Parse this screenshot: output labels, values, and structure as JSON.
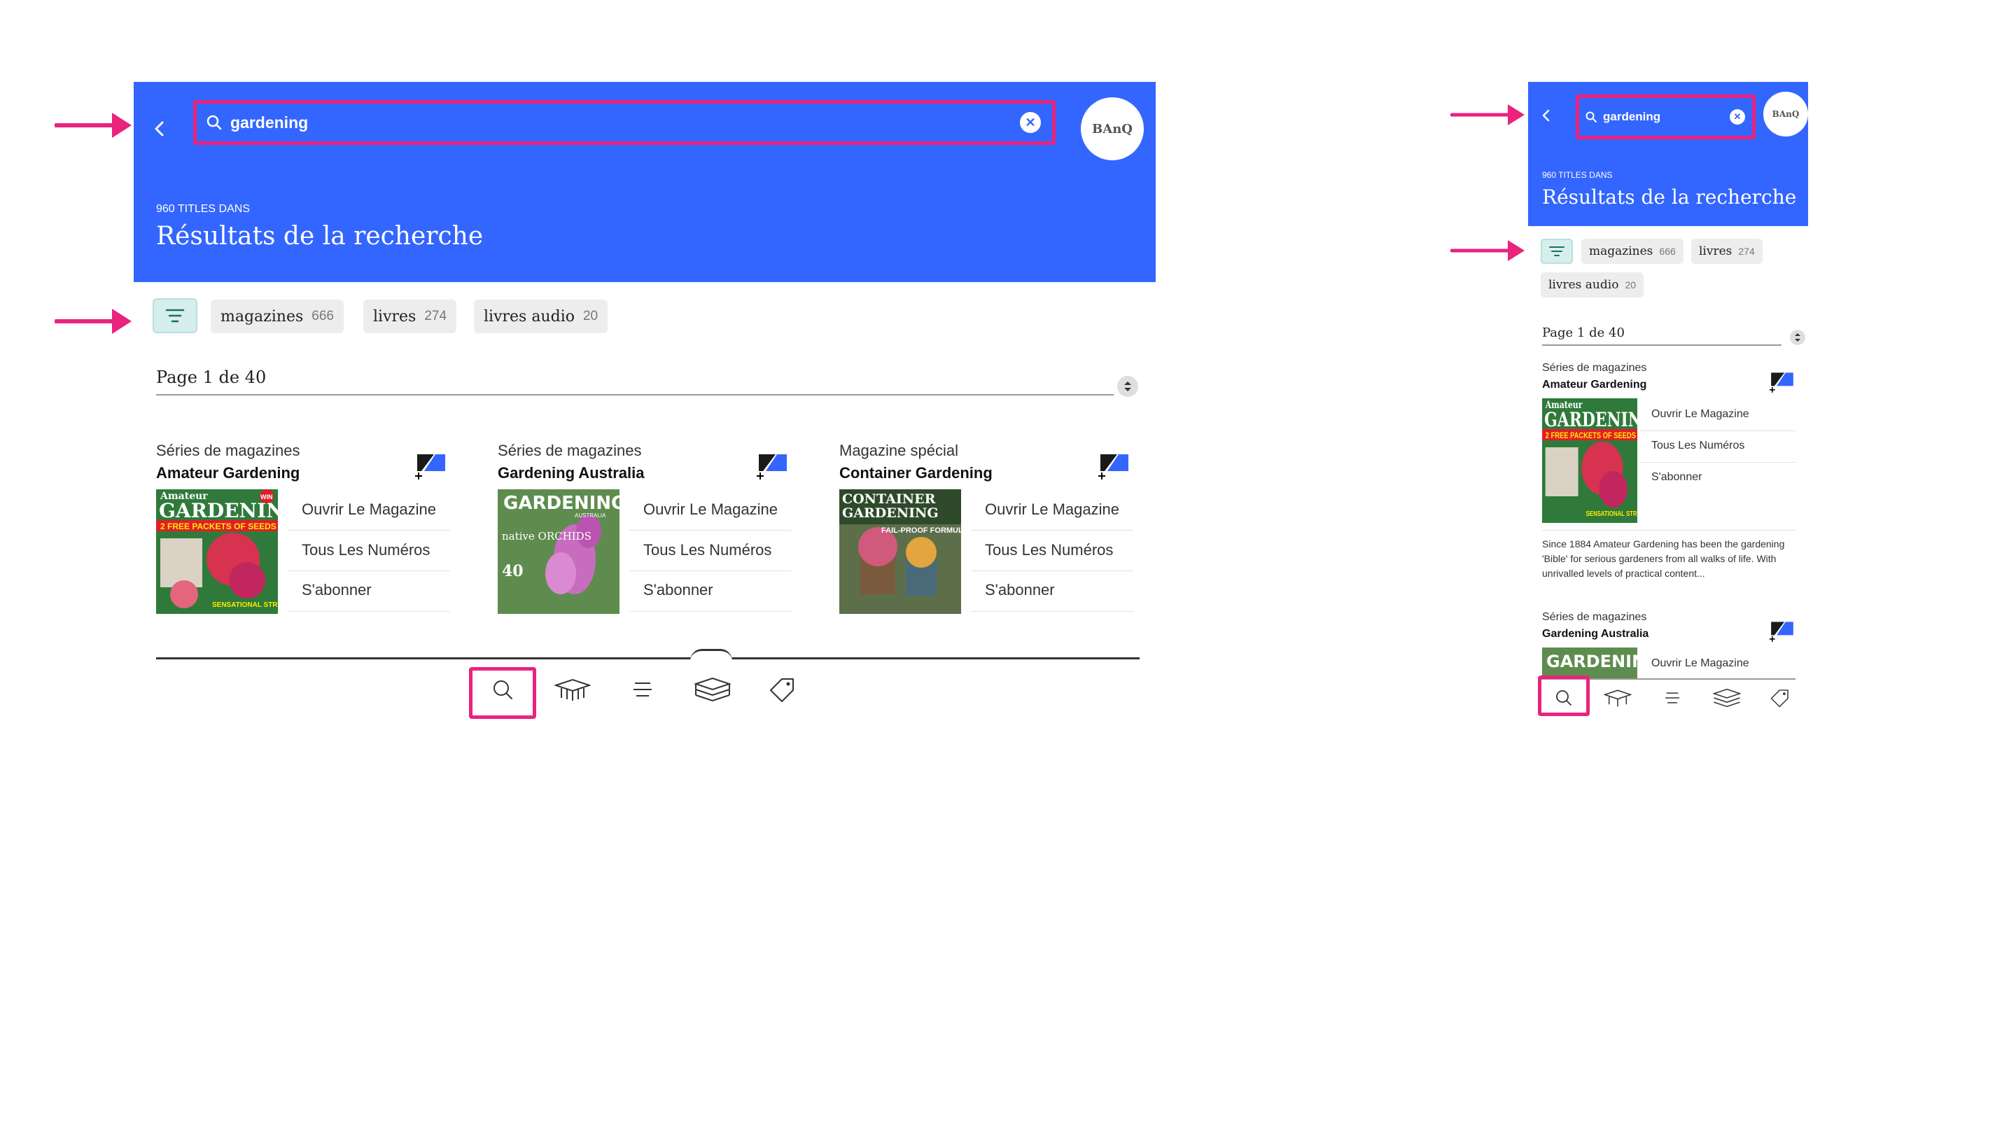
{
  "colors": {
    "header": "#3366ff",
    "highlight": "#e9237e",
    "filter_bg": "#d6efec"
  },
  "search": {
    "value": "gardening"
  },
  "logo": {
    "text": "BAnQ"
  },
  "results": {
    "count_label": "960 TITLES DANS",
    "title": "Résultats de la recherche"
  },
  "filters": [
    {
      "label": "magazines",
      "count": "666"
    },
    {
      "label": "livres",
      "count": "274"
    },
    {
      "label": "livres audio",
      "count": "20"
    }
  ],
  "pagination": {
    "label": "Page 1 de 40"
  },
  "cards": [
    {
      "type": "Séries de magazines",
      "name": "Amateur Gardening",
      "cover": {
        "masthead": "Amateur",
        "title": "GARDENING",
        "banner": "2 FREE PACKETS OF SEEDS",
        "badge": "WIN",
        "footer": "SENSATIONAL STRUCTURE!"
      },
      "actions": [
        "Ouvrir Le Magazine",
        "Tous Les Numéros",
        "S'abonner"
      ]
    },
    {
      "type": "Séries de magazines",
      "name": "Gardening Australia",
      "cover": {
        "title": "GARDENING",
        "subtitle": "AUSTRALIA",
        "feature": "native ORCHIDS",
        "count": "40"
      },
      "actions": [
        "Ouvrir Le Magazine",
        "Tous Les Numéros",
        "S'abonner"
      ]
    },
    {
      "type": "Magazine spécial",
      "name": "Container Gardening",
      "cover": {
        "title": "CONTAINER",
        "title2": "GARDENING",
        "banner": "FAIL-PROOF FORMULA"
      },
      "actions": [
        "Ouvrir Le Magazine",
        "Tous Les Numéros",
        "S'abonner"
      ]
    }
  ],
  "mobile": {
    "description": "Since 1884 Amateur Gardening has been the gardening 'Bible' for serious gardeners from all walks of life. With unrivalled levels of practical content...",
    "second_type": "Séries de magazines",
    "second_name": "Gardening Australia",
    "second_action": "Ouvrir Le Magazine"
  },
  "nav": [
    {
      "icon": "search-icon"
    },
    {
      "icon": "library-icon"
    },
    {
      "icon": "menu-icon"
    },
    {
      "icon": "books-icon"
    },
    {
      "icon": "tag-icon"
    }
  ]
}
